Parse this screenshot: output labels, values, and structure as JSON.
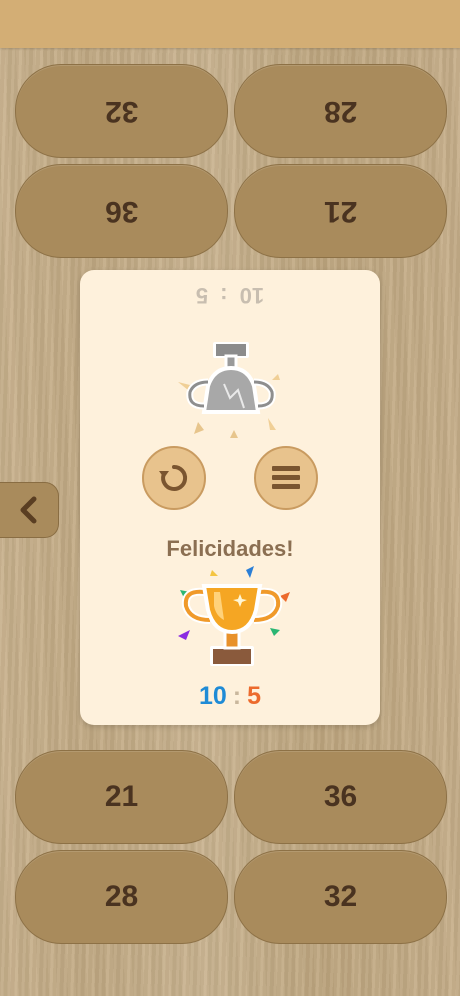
{
  "top_pills": [
    {
      "id": "p1",
      "value": "32"
    },
    {
      "id": "p2",
      "value": "28"
    },
    {
      "id": "p3",
      "value": "36"
    },
    {
      "id": "p4",
      "value": "21"
    }
  ],
  "bottom_pills": [
    {
      "id": "p5",
      "value": "21"
    },
    {
      "id": "p6",
      "value": "36"
    },
    {
      "id": "p7",
      "value": "28"
    },
    {
      "id": "p8",
      "value": "32"
    }
  ],
  "result": {
    "opponent_score_left": "10",
    "opponent_score_sep": ":",
    "opponent_score_right": "5",
    "message": "Felicidades!",
    "score_blue": "10",
    "score_sep": ":",
    "score_orange": "5"
  },
  "icons": {
    "back": "chevron-left-icon",
    "restart": "restart-icon",
    "menu": "menu-icon",
    "broken_trophy": "broken-trophy-icon",
    "trophy": "trophy-icon"
  },
  "colors": {
    "panel": "#fef1dc",
    "pill": "#a98b5c",
    "score_blue": "#1f8bd6",
    "score_orange": "#ec6a2c"
  }
}
